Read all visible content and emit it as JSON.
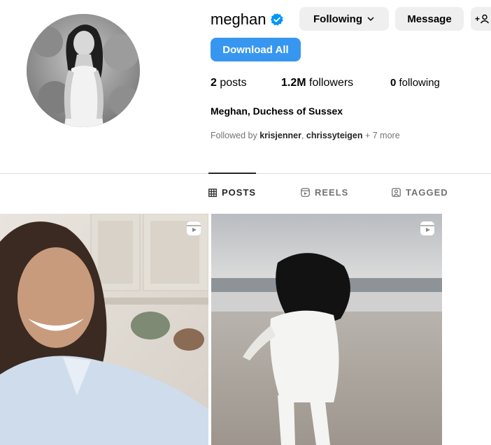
{
  "profile": {
    "username": "meghan",
    "display_name": "Meghan, Duchess of Sussex",
    "verified": true
  },
  "actions": {
    "following_label": "Following",
    "message_label": "Message",
    "add_user_label": "+",
    "download_label": "Download All"
  },
  "stats": {
    "posts_count": "2",
    "posts_label": "posts",
    "followers_count": "1.2M",
    "followers_label": "followers",
    "following_count": "0",
    "following_label": "following"
  },
  "followed_by": {
    "prefix": "Followed by ",
    "user1": "krisjenner",
    "separator": ", ",
    "user2": "chrissyteigen",
    "suffix": " + 7 more"
  },
  "tabs": [
    {
      "label": "POSTS",
      "icon": "grid-icon",
      "active": true
    },
    {
      "label": "REELS",
      "icon": "reels-icon",
      "active": false
    },
    {
      "label": "TAGGED",
      "icon": "tagged-icon",
      "active": false
    }
  ],
  "posts": [
    {
      "type": "reel",
      "icon": "reel-icon"
    },
    {
      "type": "reel",
      "icon": "reel-icon"
    }
  ],
  "colors": {
    "primary_button": "#3797f0",
    "secondary_button": "#efefef",
    "verified_badge": "#0095f6",
    "muted_text": "#737373",
    "divider": "#dbdbdb"
  }
}
